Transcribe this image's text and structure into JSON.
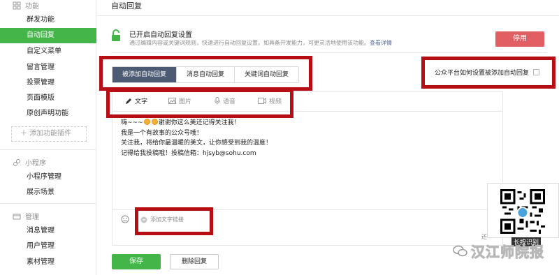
{
  "sidebar": {
    "sections": [
      {
        "title": "功能",
        "items": [
          "群发功能",
          "自动回复",
          "自定义菜单",
          "留言管理",
          "投票管理",
          "页面模版",
          "原创声明功能"
        ],
        "active_index": 1
      },
      {
        "title": "小程序",
        "items": [
          "小程序管理",
          "展示场景"
        ]
      },
      {
        "title": "管理",
        "items": [
          "消息管理",
          "用户管理",
          "素材管理"
        ]
      }
    ],
    "add_plugin": "添加功能插件"
  },
  "page_title": "自动回复",
  "notice": {
    "title": "已开启自动回复设置",
    "desc": "通过编辑内容或关键词规则，快速进行自动回复设置。如具备开发能力，可更灵活地使用该功能。",
    "link": "查看详情",
    "stop_button": "停用"
  },
  "tabs": [
    "被添加自动回复",
    "消息自动回复",
    "关键词自动回复"
  ],
  "active_tab": 0,
  "help_link": "公众平台如何设置被添加自动回复",
  "media_tabs": [
    "文字",
    "图片",
    "语音",
    "视频"
  ],
  "content": {
    "line1_pre": "嗨~~~",
    "line1_post": "谢谢你这么美还记得关注我！",
    "line2": "我是一个有故事的公众号哦！",
    "line3": "关注我，将给你最温暖的美文，让你感受到我的温度！",
    "line4": "记得给我投稿哦！投稿信箱：hjsyb@sohu.com"
  },
  "add_link": "添加文字链接",
  "counter": "还",
  "buttons": {
    "save": "保存",
    "delete": "删除回复"
  },
  "qr_caption": "长按识别",
  "watermark": "汉江师院报",
  "colors": {
    "accent_green": "#44b549",
    "stop_red": "#e15f63",
    "tab_active": "#4d5a73",
    "annotation_red": "#b70d14",
    "link_blue": "#576b95"
  }
}
